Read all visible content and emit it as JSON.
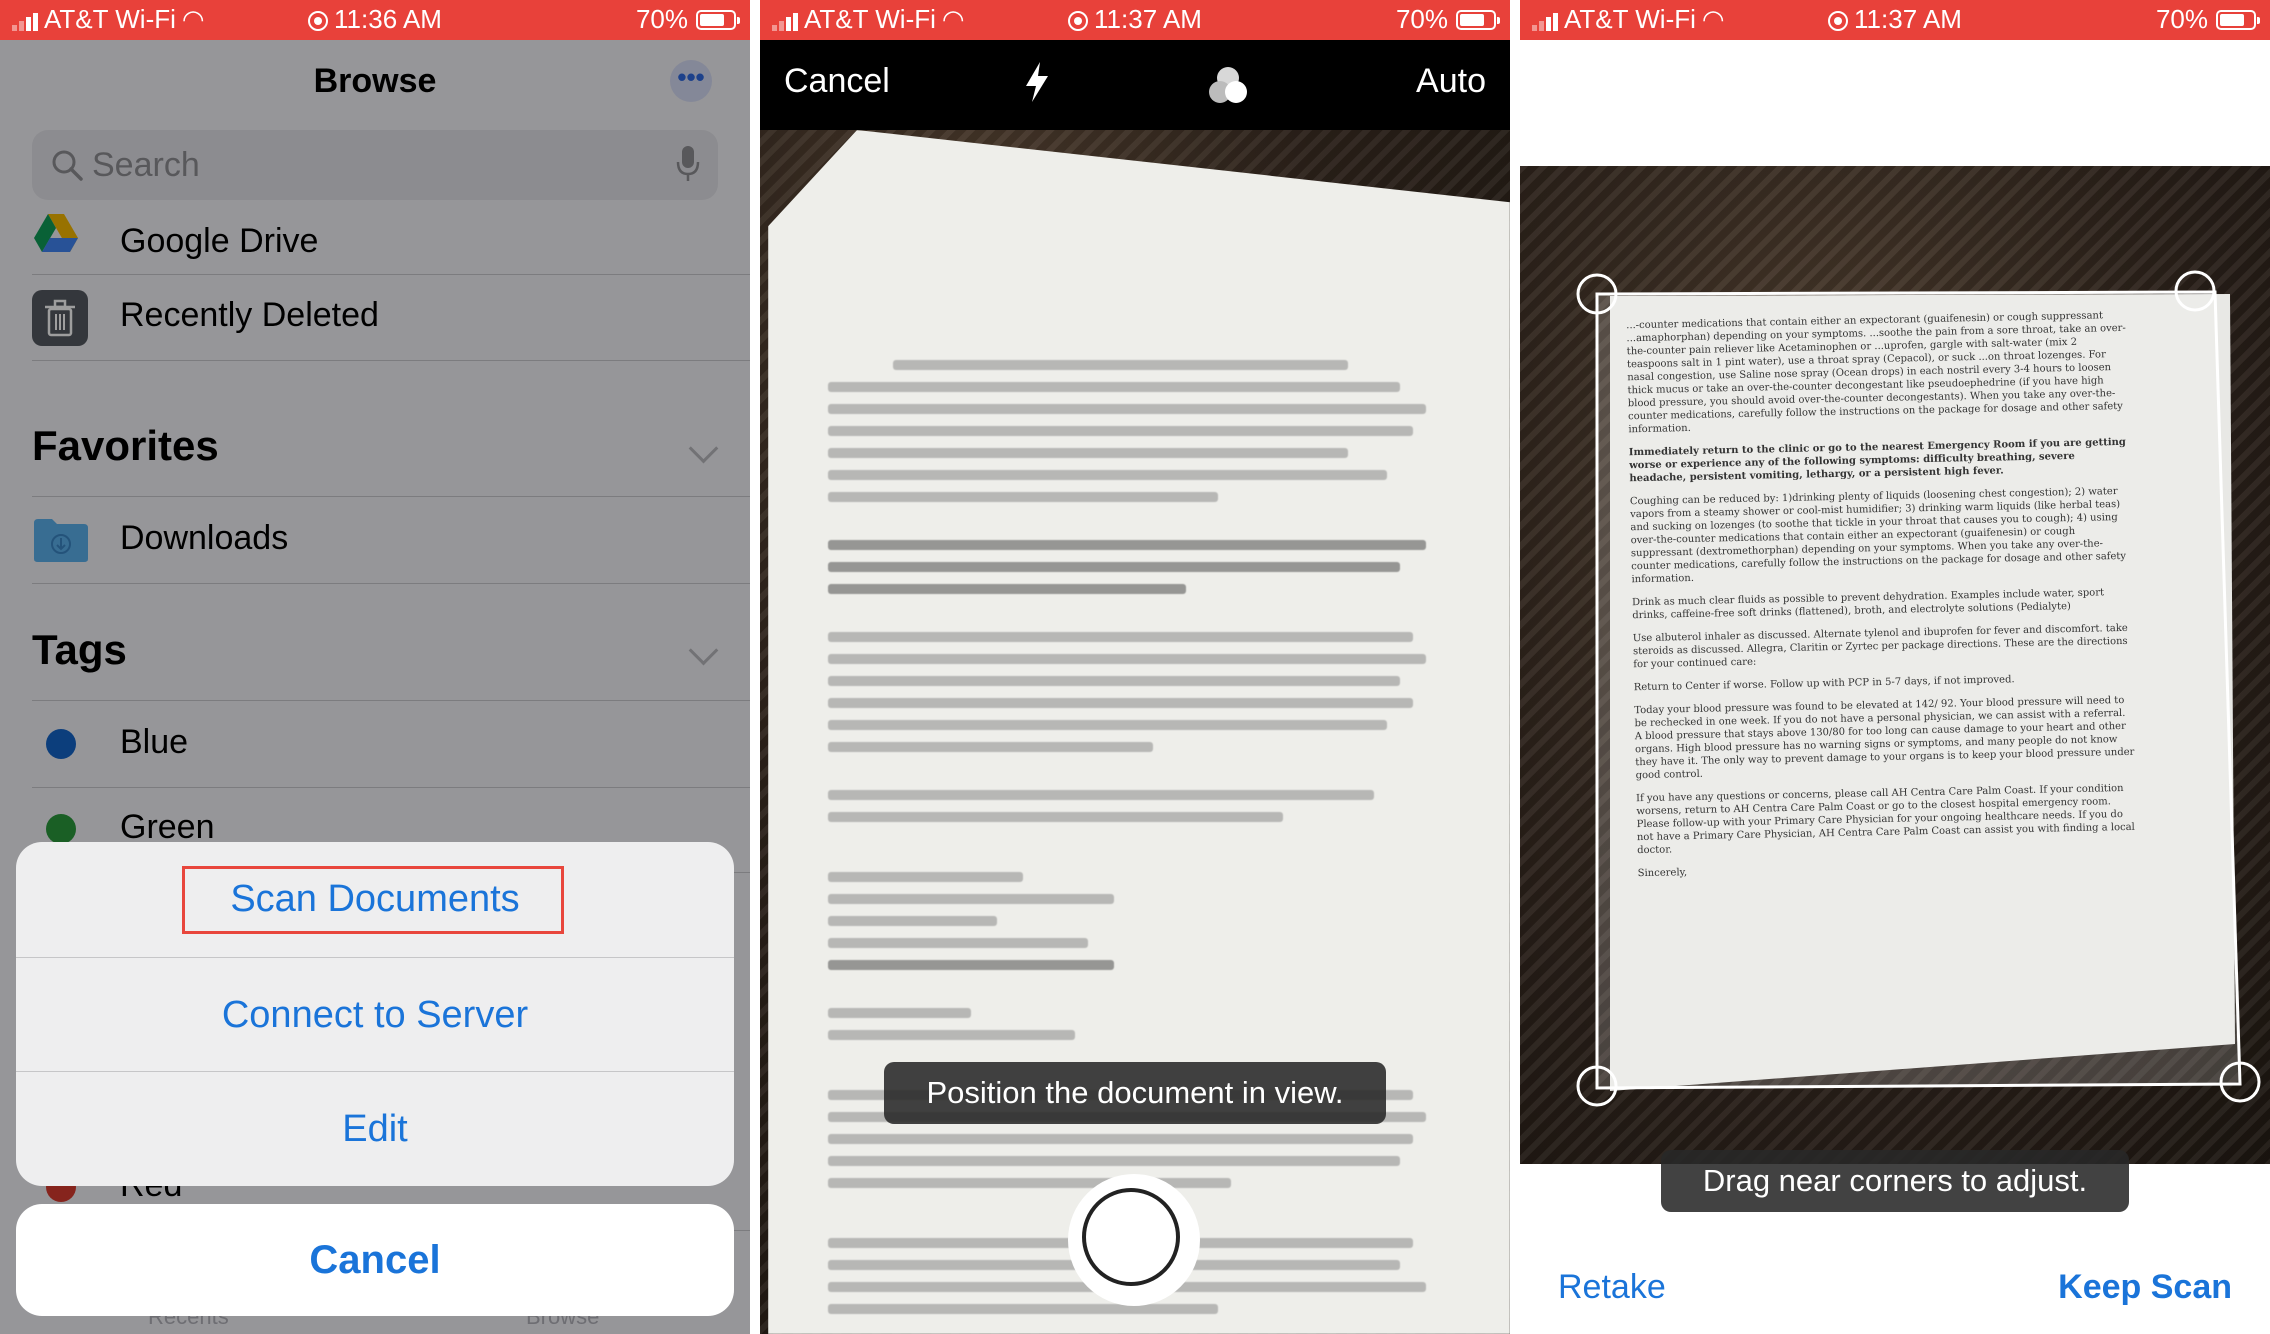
{
  "colors": {
    "accent": "#1a74d9",
    "status_bar": "#e8413a",
    "highlight": "#e8463c"
  },
  "panel1": {
    "status": {
      "carrier": "AT&T Wi-Fi",
      "time": "11:36 AM",
      "battery": "70%",
      "battery_level": 0.7
    },
    "title": "Browse",
    "search_placeholder": "Search",
    "locations": [
      {
        "label": "Google Drive",
        "icon": "google-drive-icon"
      },
      {
        "label": "Recently Deleted",
        "icon": "trash-icon"
      }
    ],
    "favorites_header": "Favorites",
    "favorites": [
      {
        "label": "Downloads",
        "icon": "folder-download-icon"
      }
    ],
    "tags_header": "Tags",
    "tags": [
      {
        "label": "Blue",
        "color": "#1464c8"
      },
      {
        "label": "Green",
        "color": "#2a9a3c"
      },
      {
        "label": "Red",
        "color": "#d83a2f"
      }
    ],
    "action_sheet": {
      "items": [
        "Scan Documents",
        "Connect to Server",
        "Edit"
      ],
      "cancel": "Cancel"
    },
    "tabbar": {
      "recents": "Recents",
      "browse": "Browse"
    }
  },
  "panel2": {
    "status": {
      "carrier": "AT&T Wi-Fi",
      "time": "11:37 AM",
      "battery": "70%",
      "battery_level": 0.7
    },
    "cancel": "Cancel",
    "mode": "Auto",
    "hint": "Position the document in view."
  },
  "panel3": {
    "status": {
      "carrier": "AT&T Wi-Fi",
      "time": "11:37 AM",
      "battery": "70%",
      "battery_level": 0.7
    },
    "hint": "Drag near corners to adjust.",
    "retake": "Retake",
    "keep": "Keep Scan",
    "document_paragraphs": [
      "...-counter medications that contain either an expectorant (guaifenesin) or cough suppressant ...amaphorphan) depending on your symptoms. ...soothe the pain from a sore throat, take an over-the-counter pain reliever like Acetaminophen or ...uprofen, gargle with salt-water (mix 2 teaspoons salt in 1 pint water), use a throat spray (Cepacol), or suck ...on throat lozenges. For nasal congestion, use Saline nose spray (Ocean drops) in each nostril every 3-4 hours to loosen thick mucus or take an over-the-counter decongestant like pseudoephedrine (if you have high blood pressure, you should avoid over-the-counter decongestants). When you take any over-the-counter medications, carefully follow the instructions on the package for dosage and other safety information.",
      "Immediately return to the clinic or go to the nearest Emergency Room if you are getting worse or experience any of the following symptoms: difficulty breathing, severe headache, persistent vomiting, lethargy, or a persistent high fever.",
      "Coughing can be reduced by: 1)drinking plenty of liquids (loosening chest congestion); 2) water vapors from a steamy shower or cool-mist humidifier; 3) drinking warm liquids (like herbal teas) and sucking on lozenges (to soothe that tickle in your throat that causes you to cough); 4) using over-the-counter medications that contain either an expectorant (guaifenesin) or cough suppressant (dextromethorphan) depending on your symptoms. When you take any over-the-counter medications, carefully follow the instructions on the package for dosage and other safety information.",
      "Drink as much clear fluids as possible to prevent dehydration. Examples include water, sport drinks, caffeine-free soft drinks (flattened), broth, and electrolyte solutions (Pedialyte)",
      "Use albuterol inhaler as discussed. Alternate tylenol and ibuprofen for fever and discomfort. take steroids as discussed. Allegra, Claritin or Zyrtec per package directions. These are the directions for your continued care:",
      "Return to Center if worse. Follow up with PCP in 5-7 days, if not improved.",
      "Today your blood pressure was found to be elevated at 142/ 92. Your blood pressure will need to be rechecked in one week. If you do not have a personal physician, we can assist with a referral. A blood pressure that stays above 130/80 for too long can cause damage to your heart and other organs. High blood pressure has no warning signs or symptoms, and many people do not know they have it. The only way to prevent damage to your organs is to keep your blood pressure under good control.",
      "If you have any questions or concerns, please call AH Centra Care Palm Coast. If your condition worsens, return to AH Centra Care Palm Coast or go to the closest hospital emergency room. Please follow-up with your Primary Care Physician for your ongoing healthcare needs. If you do not have a Primary Care Physician, AH Centra Care Palm Coast can assist you with finding a local doctor.",
      "Sincerely,"
    ]
  }
}
